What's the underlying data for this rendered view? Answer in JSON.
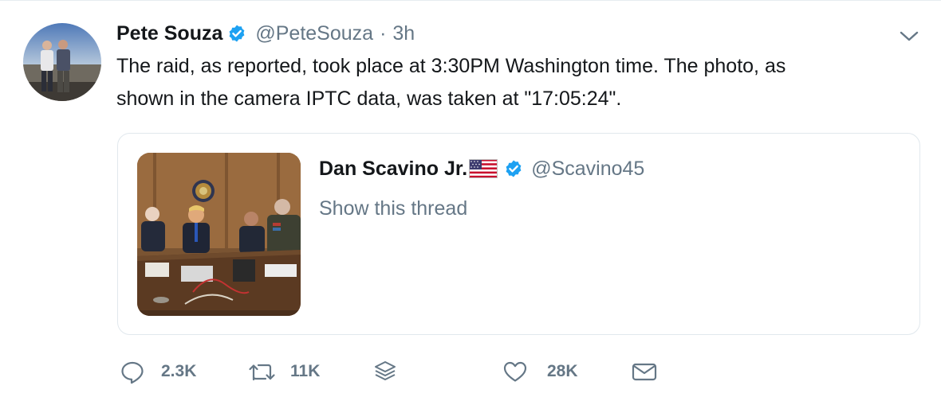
{
  "tweet": {
    "author": {
      "name": "Pete Souza",
      "handle": "@PeteSouza",
      "verified": true,
      "avatar_icon": "avatar-photo"
    },
    "separator": "·",
    "time": "3h",
    "text_lines": [
      "The raid, as reported, took place at 3:30PM Washington time. The photo, as",
      "shown in the camera IPTC data, was taken at \"17:05:24\"."
    ],
    "menu_icon": "chevron-down-icon"
  },
  "quoted_tweet": {
    "author": {
      "name": "Dan Scavino Jr.",
      "flag_icon": "us-flag-icon",
      "verified": true,
      "handle": "@Scavino45"
    },
    "show_thread_label": "Show this thread",
    "image_icon": "situation-room-photo"
  },
  "actions": {
    "reply": {
      "icon": "reply-icon",
      "count": "2.3K"
    },
    "retweet": {
      "icon": "retweet-icon",
      "count": "11K"
    },
    "stack": {
      "icon": "stack-icon"
    },
    "like": {
      "icon": "heart-icon",
      "count": "28K"
    },
    "dm": {
      "icon": "envelope-icon"
    }
  },
  "colors": {
    "text": "#14171a",
    "secondary": "#657786",
    "verified": "#1da1f2",
    "border": "#e1e8ed"
  }
}
